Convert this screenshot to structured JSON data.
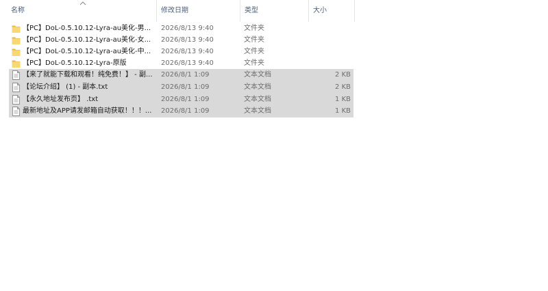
{
  "columns": {
    "name": "名称",
    "date": "修改日期",
    "type": "类型",
    "size": "大小"
  },
  "files": [
    {
      "name": "【PC】DoL-0.5.10.12-Lyra-au美化-男...",
      "date": "2026/8/13 9:40",
      "type": "文件夹",
      "size": "",
      "icon": "folder-icon",
      "selected": false
    },
    {
      "name": "【PC】DoL-0.5.10.12-Lyra-au美化-女...",
      "date": "2026/8/13 9:40",
      "type": "文件夹",
      "size": "",
      "icon": "folder-icon",
      "selected": false
    },
    {
      "name": "【PC】DoL-0.5.10.12-Lyra-au美化-中...",
      "date": "2026/8/13 9:40",
      "type": "文件夹",
      "size": "",
      "icon": "folder-icon",
      "selected": false
    },
    {
      "name": "【PC】DoL-0.5.10.12-Lyra-原版",
      "date": "2026/8/13 9:40",
      "type": "文件夹",
      "size": "",
      "icon": "folder-icon",
      "selected": false
    },
    {
      "name": "【来了就能下载和观看！纯免费！】 - 副...",
      "date": "2026/8/1 1:09",
      "type": "文本文档",
      "size": "2 KB",
      "icon": "text-file-icon",
      "selected": true
    },
    {
      "name": "【论坛介绍】 (1) - 副本.txt",
      "date": "2026/8/1 1:09",
      "type": "文本文档",
      "size": "2 KB",
      "icon": "text-file-icon",
      "selected": true
    },
    {
      "name": "【永久地址发布页】 .txt",
      "date": "2026/8/1 1:09",
      "type": "文本文档",
      "size": "1 KB",
      "icon": "text-file-icon",
      "selected": true
    },
    {
      "name": "最新地址及APP请发邮箱自动获取！！！...",
      "date": "2026/8/1 1:09",
      "type": "文本文档",
      "size": "1 KB",
      "icon": "text-file-icon",
      "selected": true
    }
  ],
  "colors": {
    "folder": "#f8d775",
    "folder_dark": "#e8b93d",
    "selection": "#d9d9d9",
    "header_text": "#4c607a"
  }
}
